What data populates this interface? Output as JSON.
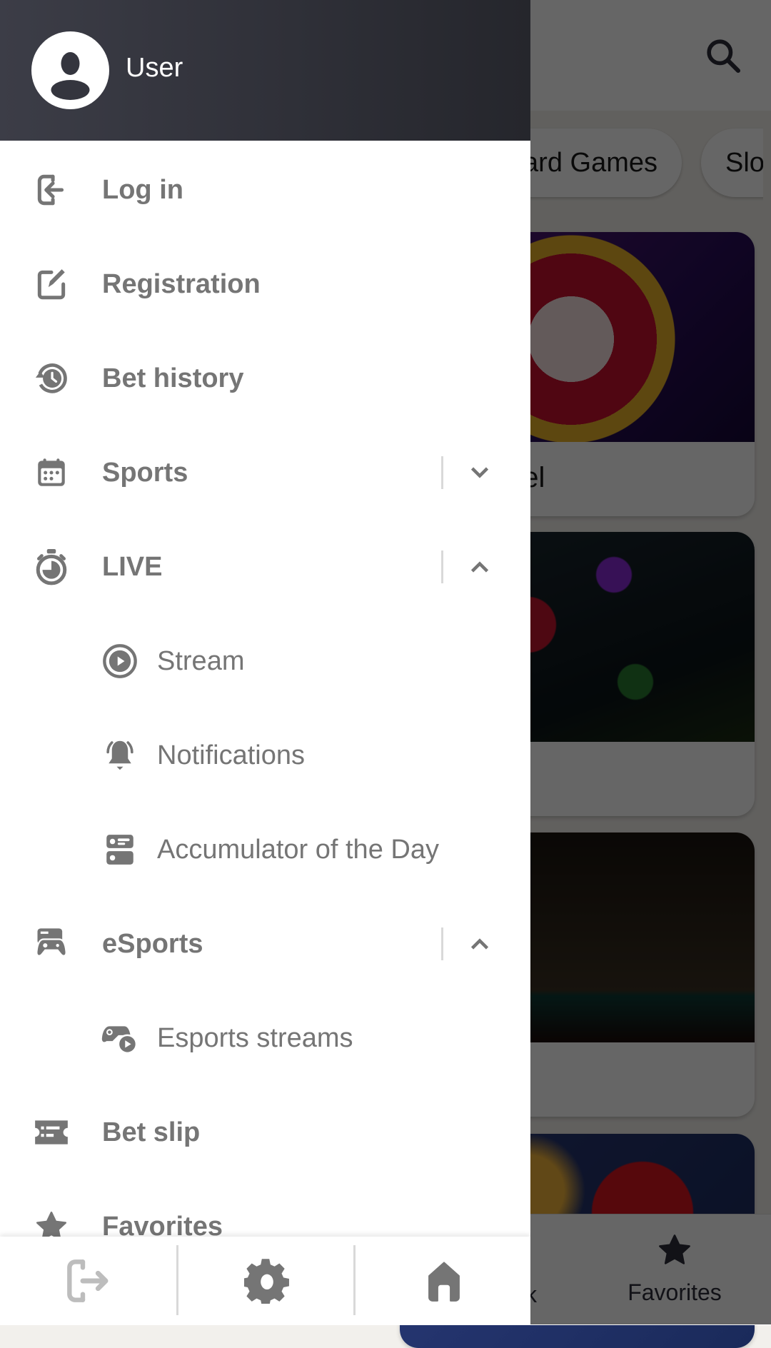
{
  "background_app": {
    "search_icon": "search-icon",
    "chips": [
      "Card Games",
      "Slots"
    ],
    "chips_visible_text": [
      "ard Games",
      "Slo"
    ],
    "game_cards": [
      {
        "title_visible": "eel",
        "image": "wheel-of-fortune"
      },
      {
        "title_visible": "",
        "image": "gems"
      },
      {
        "title_visible": "",
        "image": "dice"
      },
      {
        "title_visible": "",
        "image": "fruits"
      }
    ],
    "bottom_nav": {
      "partial_label": "k",
      "favorites_label": "Favorites",
      "favorites_icon": "star-icon"
    }
  },
  "drawer": {
    "header": {
      "user_name": "User",
      "avatar_icon": "user-avatar-icon"
    },
    "items": [
      {
        "label": "Log in",
        "icon": "login-icon",
        "level": 0
      },
      {
        "label": "Registration",
        "icon": "edit-icon",
        "level": 0
      },
      {
        "label": "Bet history",
        "icon": "history-icon",
        "level": 0
      },
      {
        "label": "Sports",
        "icon": "calendar-icon",
        "level": 0,
        "expandable": true,
        "expanded": false
      },
      {
        "label": "LIVE",
        "icon": "stopwatch-icon",
        "level": 0,
        "expandable": true,
        "expanded": true
      },
      {
        "label": "Stream",
        "icon": "play-circle-icon",
        "level": 1
      },
      {
        "label": "Notifications",
        "icon": "bell-ringing-icon",
        "level": 1
      },
      {
        "label": "Accumulator of the Day",
        "icon": "accumulator-icon",
        "level": 1
      },
      {
        "label": "eSports",
        "icon": "esports-icon",
        "level": 0,
        "expandable": true,
        "expanded": true
      },
      {
        "label": "Esports streams",
        "icon": "gamepad-play-icon",
        "level": 1
      },
      {
        "label": "Bet slip",
        "icon": "ticket-icon",
        "level": 0
      },
      {
        "label": "Favorites",
        "icon": "star-icon",
        "level": 0
      }
    ],
    "bottom_bar": [
      {
        "icon": "logout-icon",
        "enabled": false
      },
      {
        "icon": "settings-gear-icon",
        "enabled": true
      },
      {
        "icon": "home-icon",
        "enabled": true
      }
    ]
  },
  "colors": {
    "menu_text": "#757575",
    "header_bg": "#34353e",
    "divider": "#d9d9d9",
    "disabled_icon": "#bdbdbd"
  }
}
